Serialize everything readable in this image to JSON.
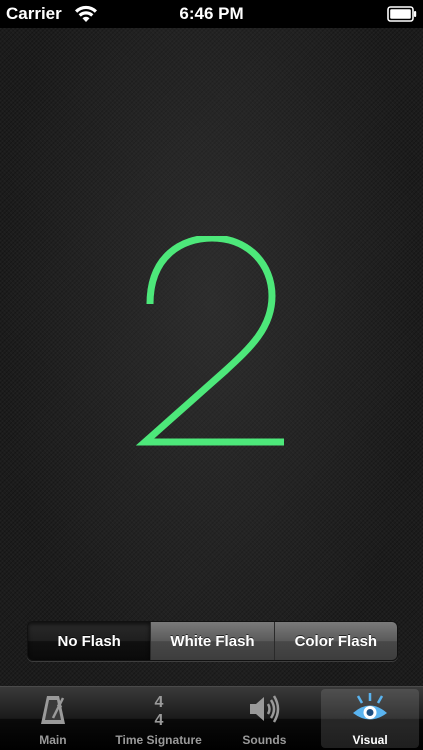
{
  "status_bar": {
    "carrier": "Carrier",
    "time": "6:46 PM",
    "wifi_icon": "wifi-icon",
    "battery_icon": "battery-icon"
  },
  "display": {
    "beat_number": "2",
    "color": "#4de87a"
  },
  "flash_modes": {
    "options": [
      "No Flash",
      "White Flash",
      "Color Flash"
    ],
    "selected": "No Flash"
  },
  "tab_bar": {
    "tabs": [
      {
        "label": "Main",
        "icon": "metronome-icon"
      },
      {
        "label": "Time Signature",
        "icon": "time-signature-icon",
        "icon_text_top": "4",
        "icon_text_bottom": "4"
      },
      {
        "label": "Sounds",
        "icon": "speaker-icon"
      },
      {
        "label": "Visual",
        "icon": "eye-icon"
      }
    ],
    "selected": "Visual",
    "selected_color": "#5ab4f0"
  }
}
